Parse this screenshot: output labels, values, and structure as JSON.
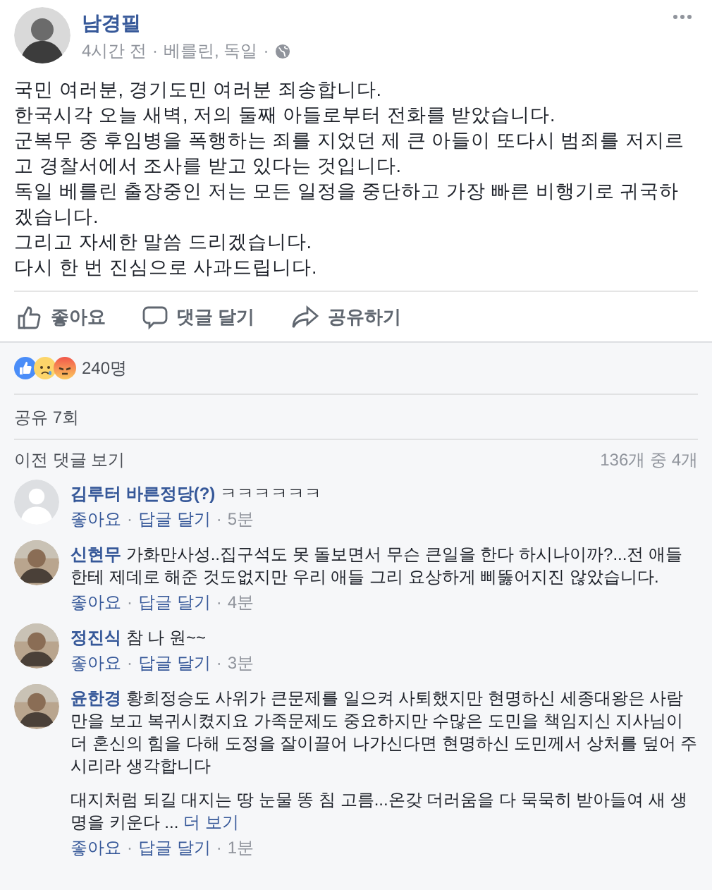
{
  "post": {
    "author": "남경필",
    "time": "4시간 전",
    "location": "베를린, 독일",
    "separator": "·",
    "paragraphs": [
      "국민 여러분, 경기도민 여러분 죄송합니다.",
      "한국시각 오늘 새벽, 저의 둘째 아들로부터 전화를 받았습니다.",
      "군복무 중 후임병을 폭행하는 죄를 지었던 제 큰 아들이 또다시 범죄를 저지르고 경찰서에서 조사를 받고 있다는 것입니다.",
      "독일 베를린 출장중인 저는 모든 일정을 중단하고 가장 빠른 비행기로 귀국하겠습니다.",
      "그리고 자세한 말씀 드리겠습니다.",
      "다시 한 번 진심으로 사과드립니다."
    ]
  },
  "actions": [
    {
      "kind": "like",
      "label": "좋아요"
    },
    {
      "kind": "comment",
      "label": "댓글 달기"
    },
    {
      "kind": "share",
      "label": "공유하기"
    }
  ],
  "reactions": {
    "items": [
      {
        "kind": "like"
      },
      {
        "kind": "sad"
      },
      {
        "kind": "angry"
      }
    ],
    "count": "240명"
  },
  "shares": "공유 7회",
  "comments_header": {
    "link": "이전 댓글 보기",
    "count": "136개 중 4개"
  },
  "comments": [
    {
      "author": "김루터 바른정당(?)",
      "text": "ㅋㅋㅋㅋㅋㅋ",
      "avatar": {
        "kind": "default"
      },
      "like": "좋아요",
      "reply": "답글 달기",
      "time": "5분"
    },
    {
      "author": "신현무",
      "text": "가화만사성..집구석도 못 돌보면서 무슨 큰일을 한다 하시나이까?...전 애들한테 제데로 해준 것도없지만 우리 애들 그리 요상하게 삐뚫어지진 않았습니다.",
      "like": "좋아요",
      "reply": "답글 달기",
      "time": "4분"
    },
    {
      "author": "정진식",
      "text": "참 나 원~~",
      "like": "좋아요",
      "reply": "답글 달기",
      "time": "3분"
    },
    {
      "author": "윤한경",
      "text": "황희정승도 사위가 큰문제를 일으켜 사퇴했지만 현명하신 세종대왕은 사람만을 보고 복귀시켰지요 가족문제도 중요하지만 수많은 도민을 책임지신 지사님이 더 혼신의 힘을 다해 도정을 잘이끌어 나가신다면 현명하신 도민께서 상처를 덮어 주시리라 생각합니다",
      "extra": "대지처럼 되길 대지는 땅 눈물 똥 침 고름...온갖 더러움을 다 묵묵히 받아들여 새 생명을 키운다 ...",
      "more": "더 보기",
      "like": "좋아요",
      "reply": "답글 달기",
      "time": "1분"
    }
  ]
}
